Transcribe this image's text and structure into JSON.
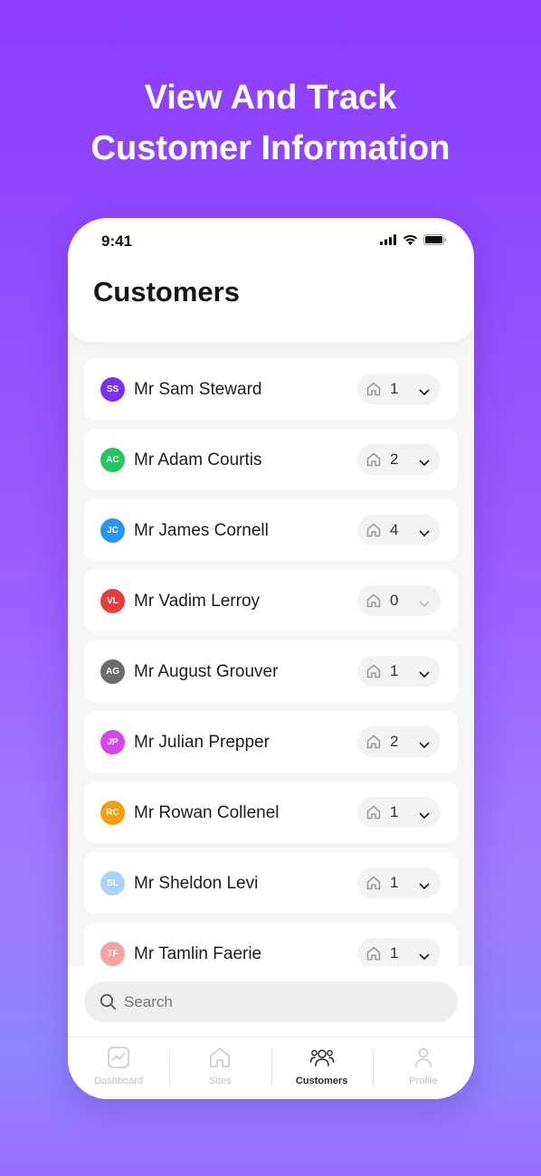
{
  "headline": {
    "line1": "View And Track",
    "line2": "Customer Information"
  },
  "status_bar": {
    "time": "9:41",
    "icons": [
      "cellular-signal-icon",
      "wifi-icon",
      "battery-icon"
    ]
  },
  "page": {
    "title": "Customers"
  },
  "customers": [
    {
      "initials": "SS",
      "name": "Mr Sam Steward",
      "sites": "1",
      "avatar_color": "#7b2ff7",
      "expandable": true
    },
    {
      "initials": "AC",
      "name": "Mr Adam Courtis",
      "sites": "2",
      "avatar_color": "#22c55e",
      "expandable": true
    },
    {
      "initials": "JC",
      "name": "Mr James Cornell",
      "sites": "4",
      "avatar_color": "#2b95f5",
      "expandable": true
    },
    {
      "initials": "VL",
      "name": "Mr Vadim Lerroy",
      "sites": "0",
      "avatar_color": "#e53e3e",
      "expandable": false
    },
    {
      "initials": "AG",
      "name": "Mr August Grouver",
      "sites": "1",
      "avatar_color": "#6b6b6b",
      "expandable": true
    },
    {
      "initials": "JP",
      "name": "Mr Julian Prepper",
      "sites": "2",
      "avatar_color": "#d946ef",
      "expandable": true
    },
    {
      "initials": "RC",
      "name": "Mr Rowan Collenel",
      "sites": "1",
      "avatar_color": "#f59e0b",
      "expandable": true
    },
    {
      "initials": "SL",
      "name": "Mr Sheldon Levi",
      "sites": "1",
      "avatar_color": "#a9d3fb",
      "expandable": true
    },
    {
      "initials": "TF",
      "name": "Mr Tamlin Faerie",
      "sites": "1",
      "avatar_color": "#f7a1a1",
      "expandable": true
    }
  ],
  "search": {
    "placeholder": "Search",
    "value": ""
  },
  "tabs": [
    {
      "label": "Dashboard",
      "icon": "dashboard-icon",
      "active": false
    },
    {
      "label": "Sites",
      "icon": "home-icon",
      "active": false
    },
    {
      "label": "Customers",
      "icon": "users-icon",
      "active": true
    },
    {
      "label": "Profile",
      "icon": "user-icon",
      "active": false
    }
  ],
  "colors": {
    "accent": "#8b3cff",
    "text_dark": "#1d1d1d",
    "tab_inactive": "#c2c2c2"
  }
}
